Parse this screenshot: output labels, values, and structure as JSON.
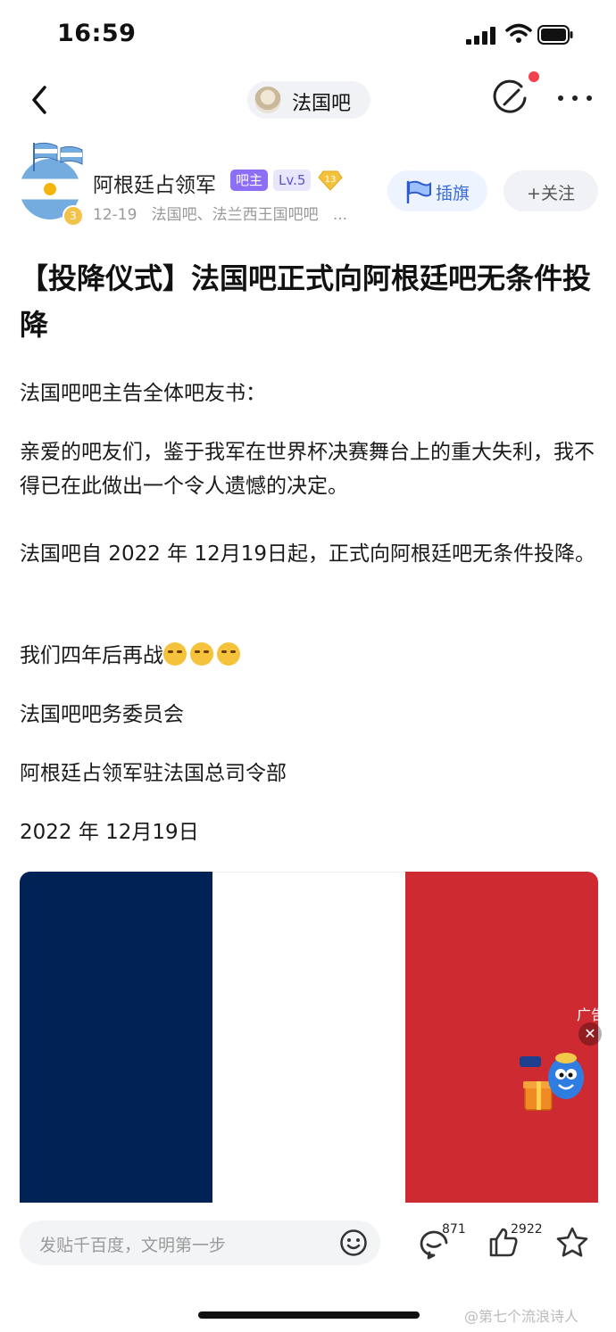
{
  "status_bar": {
    "time": "16:59"
  },
  "nav": {
    "back_icon": "chevron-left-icon",
    "forum_name": "法国吧",
    "edit_icon": "edit-icon",
    "more_icon": "more-icon"
  },
  "author": {
    "name": "阿根廷占领军",
    "owner_tag": "吧主",
    "level_tag": "Lv.5",
    "gem_count": "13",
    "avatar_badge": "3",
    "date": "12-19",
    "forums": "法国吧、法兰西王国吧吧",
    "ellipsis": "...",
    "flag_button": "插旗",
    "follow_button": "+关注"
  },
  "post": {
    "title": "【投降仪式】法国吧正式向阿根廷吧无条件投降",
    "paragraphs": [
      "法国吧吧主告全体吧友书：",
      "亲爱的吧友们，鉴于我军在世界杯决赛舞台上的重大失利，我不得已在此做出一个令人遗憾的决定。",
      "法国吧自 2022 年 12月19日起，正式向阿根廷吧无条件投降。",
      "我们四年后再战",
      "法国吧吧务委员会",
      "阿根廷占领军驻法国总司令部",
      "2022 年 12月19日"
    ],
    "emoji_icon": "crying-face-icon",
    "emoji_count": 3
  },
  "image": {
    "colors": {
      "blue": "#002254",
      "white": "#ffffff",
      "red": "#ce2a31"
    }
  },
  "ad": {
    "label": "广告",
    "close": "✕"
  },
  "bottom_bar": {
    "reply_placeholder": "发贴千百度，文明第一步",
    "comment_count": "871",
    "like_count": "2922"
  },
  "watermark": "@第七个流浪诗人"
}
